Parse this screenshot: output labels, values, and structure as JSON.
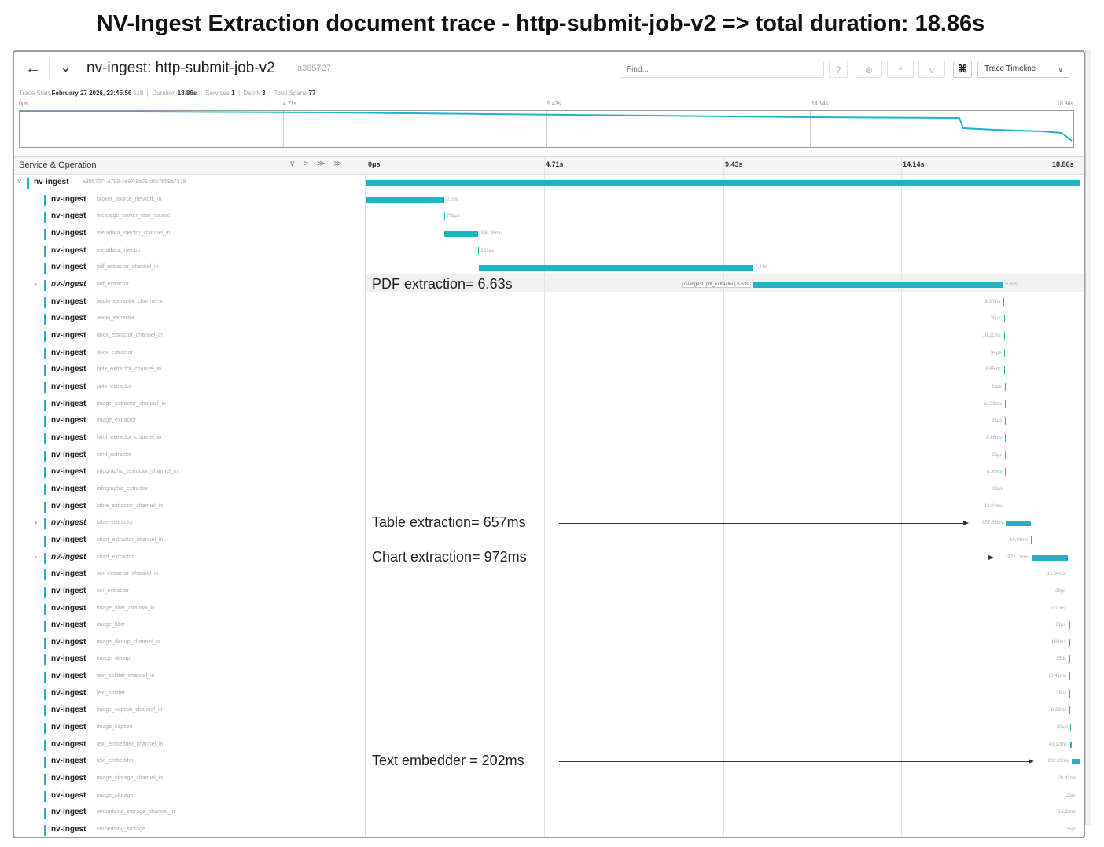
{
  "page_title": "NV-Ingest Extraction document trace - http-submit-job-v2 => total duration: 18.86s",
  "header": {
    "back_icon": "arrow-left-icon",
    "collapse_icon": "chevron-down-icon",
    "trace_name": "nv-ingest: http-submit-job-v2",
    "trace_id": "a385727",
    "find_placeholder": "Find...",
    "help_symbol": "?",
    "close_symbol": "⊗",
    "prev_symbol": "^",
    "next_symbol": "v",
    "cmd_symbol": "⌘",
    "view_label": "Trace Timeline",
    "view_caret": "v"
  },
  "stats": {
    "trace_start_label": "Trace Start",
    "trace_start_value": "February 27 2026, 23:45:56",
    "trace_start_ms": ".118",
    "duration_label": "Duration",
    "duration_value": "18.86s",
    "services_label": "Services",
    "services_value": "1",
    "depth_label": "Depth",
    "depth_value": "3",
    "total_spans_label": "Total Spans",
    "total_spans_value": "77"
  },
  "minimap_ticks": [
    "0μs",
    "4.71s",
    "9.43s",
    "14.14s",
    "18.86s"
  ],
  "timeline": {
    "column_header": "Service & Operation",
    "column_controls": "∨ > ≫ ≫",
    "ticks": [
      "0μs",
      "4.71s",
      "9.43s",
      "14.14s",
      "18.86s"
    ]
  },
  "colors": {
    "span_bar": "#1fb3c3",
    "service_marker": "#1fb3c3"
  },
  "spans": [
    {
      "service": "nv-ingest",
      "op": "a385727f-a793-4e97-9b03-d5c7659a7378",
      "duration": "",
      "root": true,
      "expandable": true,
      "start_s": 0,
      "end_s": 18.86
    },
    {
      "service": "nv-ingest",
      "op": "broker_source_network_in",
      "duration": "2.08s",
      "start_s": 0,
      "end_s": 2.08
    },
    {
      "service": "nv-ingest",
      "op": "message_broker_task_source",
      "duration": "792μs",
      "start_s": 2.08,
      "end_s": 2.081
    },
    {
      "service": "nv-ingest",
      "op": "metadata_injector_channel_in",
      "duration": "898.36ms",
      "start_s": 2.081,
      "end_s": 2.98
    },
    {
      "service": "nv-ingest",
      "op": "metadata_injector",
      "duration": "361μs",
      "start_s": 2.98,
      "end_s": 2.981
    },
    {
      "service": "nv-ingest",
      "op": "pdf_extractor_channel_in",
      "duration": "7.24s",
      "start_s": 2.981,
      "end_s": 10.22
    },
    {
      "service": "nv-ingest",
      "op": "pdf_extractor",
      "duration": "6.63s",
      "expandable": true,
      "start_s": 10.22,
      "end_s": 16.85,
      "label": "nv-ingest::pdf_extractor | 6.63s"
    },
    {
      "service": "nv-ingest",
      "op": "audio_extractor_channel_in",
      "duration": "8.30ms",
      "start_s": 16.85,
      "end_s": 16.858
    },
    {
      "service": "nv-ingest",
      "op": "audio_extractor",
      "duration": "39μs",
      "start_s": 16.858,
      "end_s": 16.858
    },
    {
      "service": "nv-ingest",
      "op": "docx_extractor_channel_in",
      "duration": "10.21ms",
      "start_s": 16.858,
      "end_s": 16.868
    },
    {
      "service": "nv-ingest",
      "op": "docx_extractor",
      "duration": "34μs",
      "start_s": 16.868,
      "end_s": 16.868
    },
    {
      "service": "nv-ingest",
      "op": "pptx_extractor_channel_in",
      "duration": "9.65ms",
      "start_s": 16.868,
      "end_s": 16.878
    },
    {
      "service": "nv-ingest",
      "op": "pptx_extractor",
      "duration": "32μs",
      "start_s": 16.878,
      "end_s": 16.878
    },
    {
      "service": "nv-ingest",
      "op": "image_extractor_channel_in",
      "duration": "10.56ms",
      "start_s": 16.878,
      "end_s": 16.889
    },
    {
      "service": "nv-ingest",
      "op": "image_extractor",
      "duration": "31μs",
      "start_s": 16.889,
      "end_s": 16.889
    },
    {
      "service": "nv-ingest",
      "op": "html_extractor_channel_in",
      "duration": "8.65ms",
      "start_s": 16.889,
      "end_s": 16.897
    },
    {
      "service": "nv-ingest",
      "op": "html_extractor",
      "duration": "25μs",
      "start_s": 16.897,
      "end_s": 16.897
    },
    {
      "service": "nv-ingest",
      "op": "infographic_extractor_channel_in",
      "duration": "8.36ms",
      "start_s": 16.897,
      "end_s": 16.906
    },
    {
      "service": "nv-ingest",
      "op": "infographic_extractor",
      "duration": "33μs",
      "start_s": 16.906,
      "end_s": 16.906
    },
    {
      "service": "nv-ingest",
      "op": "table_extractor_channel_in",
      "duration": "13.04ms",
      "start_s": 16.906,
      "end_s": 16.919
    },
    {
      "service": "nv-ingest",
      "op": "table_extractor",
      "duration": "657.35ms",
      "expandable": true,
      "start_s": 16.919,
      "end_s": 17.576
    },
    {
      "service": "nv-ingest",
      "op": "chart_extractor_channel_in",
      "duration": "10.91ms",
      "start_s": 17.576,
      "end_s": 17.587
    },
    {
      "service": "nv-ingest",
      "op": "chart_extractor",
      "duration": "972.19ms",
      "expandable": true,
      "start_s": 17.587,
      "end_s": 18.559
    },
    {
      "service": "nv-ingest",
      "op": "ocr_extractor_channel_in",
      "duration": "12.64ms",
      "start_s": 18.559,
      "end_s": 18.572
    },
    {
      "service": "nv-ingest",
      "op": "ocr_extractor",
      "duration": "29μs",
      "start_s": 18.572,
      "end_s": 18.572
    },
    {
      "service": "nv-ingest",
      "op": "image_filter_channel_in",
      "duration": "8.07ms",
      "start_s": 18.572,
      "end_s": 18.58
    },
    {
      "service": "nv-ingest",
      "op": "image_filter",
      "duration": "27μs",
      "start_s": 18.58,
      "end_s": 18.58
    },
    {
      "service": "nv-ingest",
      "op": "image_dedup_channel_in",
      "duration": "8.63ms",
      "start_s": 18.58,
      "end_s": 18.589
    },
    {
      "service": "nv-ingest",
      "op": "image_dedup",
      "duration": "35μs",
      "start_s": 18.589,
      "end_s": 18.589
    },
    {
      "service": "nv-ingest",
      "op": "text_splitter_channel_in",
      "duration": "10.41ms",
      "start_s": 18.589,
      "end_s": 18.599
    },
    {
      "service": "nv-ingest",
      "op": "text_splitter",
      "duration": "28μs",
      "start_s": 18.599,
      "end_s": 18.599
    },
    {
      "service": "nv-ingest",
      "op": "image_caption_channel_in",
      "duration": "8.29ms",
      "start_s": 18.599,
      "end_s": 18.607
    },
    {
      "service": "nv-ingest",
      "op": "image_caption",
      "duration": "30μs",
      "start_s": 18.607,
      "end_s": 18.607
    },
    {
      "service": "nv-ingest",
      "op": "text_embedder_channel_in",
      "duration": "43.12ms",
      "start_s": 18.607,
      "end_s": 18.65
    },
    {
      "service": "nv-ingest",
      "op": "text_embedder",
      "duration": "202.05ms",
      "start_s": 18.65,
      "end_s": 18.852
    },
    {
      "service": "nv-ingest",
      "op": "image_storage_channel_in",
      "duration": "20.41ms",
      "start_s": 18.852,
      "end_s": 18.86
    },
    {
      "service": "nv-ingest",
      "op": "image_storage",
      "duration": "23μs",
      "start_s": 18.86,
      "end_s": 18.86
    },
    {
      "service": "nv-ingest",
      "op": "embedding_storage_channel_in",
      "duration": "15.32ms",
      "start_s": 18.86,
      "end_s": 18.86
    },
    {
      "service": "nv-ingest",
      "op": "embedding_storage",
      "duration": "25μs",
      "start_s": 18.86,
      "end_s": 18.86
    }
  ],
  "annotations": [
    {
      "text": "PDF extraction= 6.63s",
      "row": 6,
      "arrow": false
    },
    {
      "text": "Table extraction= 657ms",
      "row": 20,
      "arrow": true
    },
    {
      "text": "Chart extraction= 972ms",
      "row": 22,
      "arrow": true
    },
    {
      "text": "Text embedder = 202ms",
      "row": 34,
      "arrow": true
    }
  ]
}
